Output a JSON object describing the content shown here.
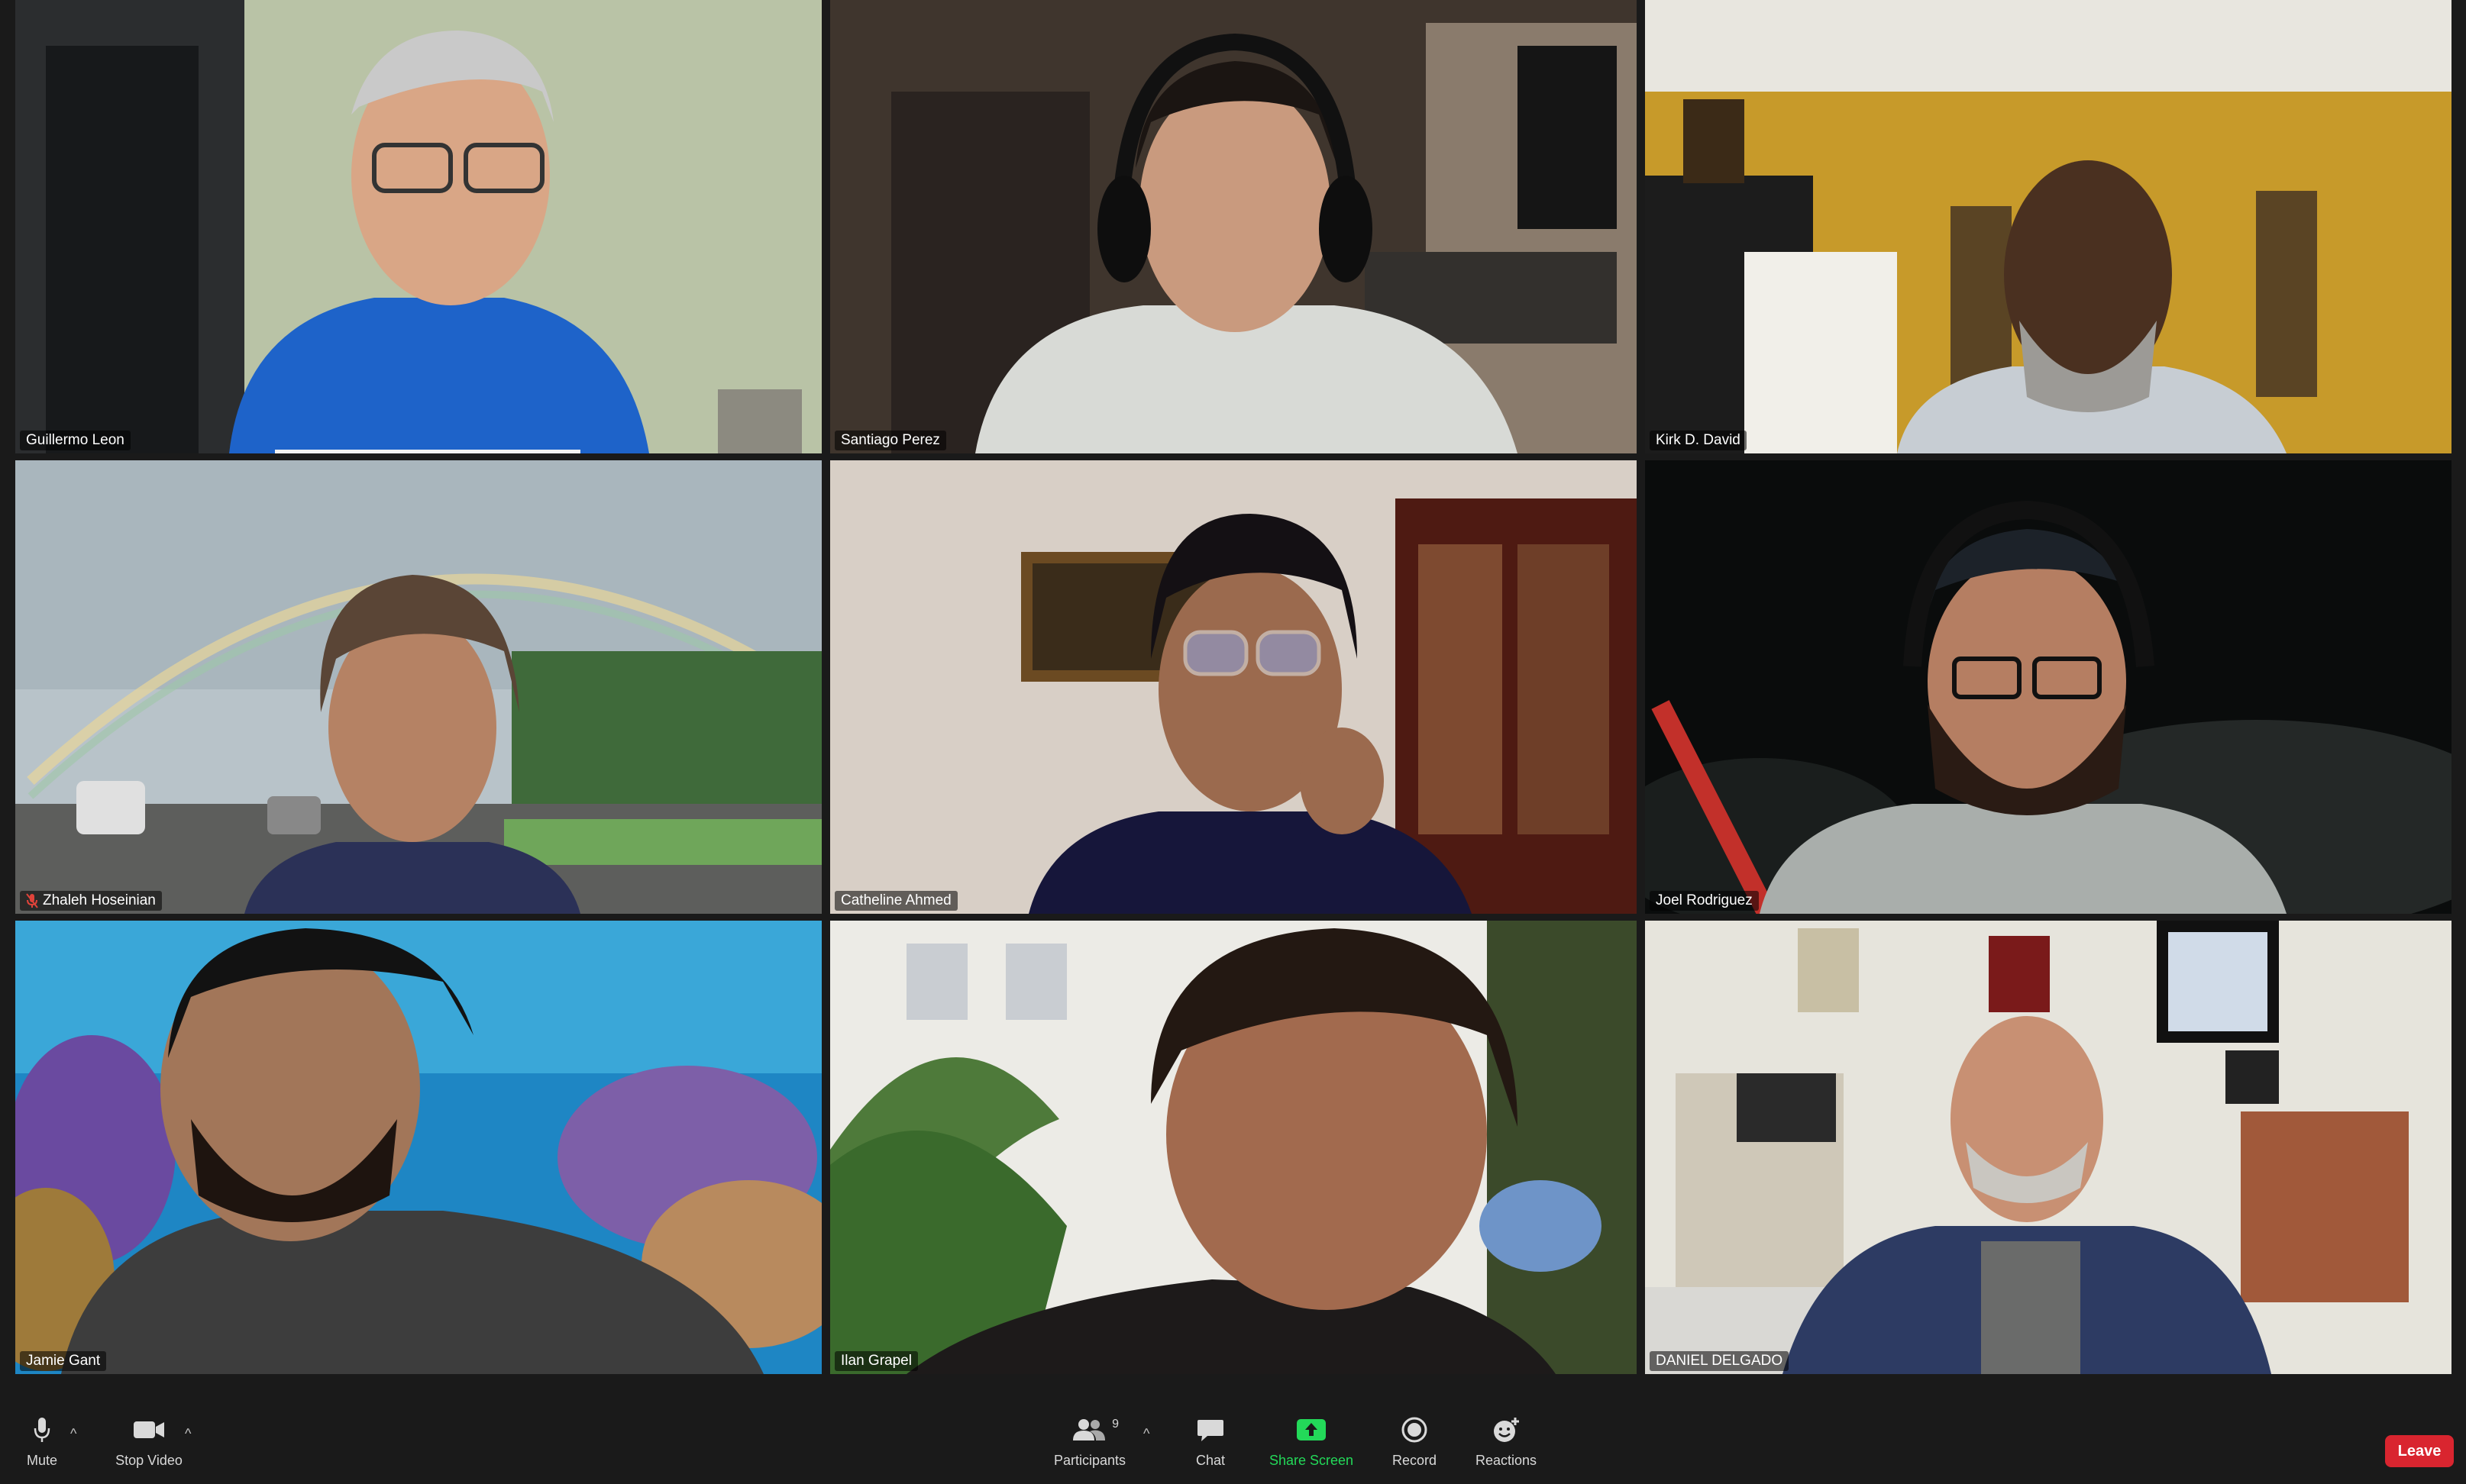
{
  "participants": [
    {
      "name": "Guillermo Leon",
      "muted": false,
      "active_speaker": false,
      "speaking_bar": true
    },
    {
      "name": "Santiago Perez",
      "muted": false,
      "active_speaker": false
    },
    {
      "name": "Kirk D. David",
      "muted": false,
      "active_speaker": false
    },
    {
      "name": "Zhaleh Hoseinian",
      "muted": true,
      "active_speaker": false
    },
    {
      "name": "Catheline Ahmed",
      "muted": false,
      "active_speaker": false
    },
    {
      "name": "Joel Rodriguez",
      "muted": false,
      "active_speaker": false
    },
    {
      "name": "Jamie Gant",
      "muted": false,
      "active_speaker": true
    },
    {
      "name": "Ilan Grapel",
      "muted": false,
      "active_speaker": false
    },
    {
      "name": "DANIEL DELGADO",
      "muted": false,
      "active_speaker": false
    }
  ],
  "toolbar": {
    "mute_label": "Mute",
    "stop_video_label": "Stop Video",
    "participants_label": "Participants",
    "participants_count": "9",
    "chat_label": "Chat",
    "share_screen_label": "Share Screen",
    "record_label": "Record",
    "reactions_label": "Reactions",
    "leave_label": "Leave"
  },
  "colors": {
    "active_speaker_border": "#e8e26a",
    "share_screen_green": "#23d959",
    "leave_red": "#d9252f",
    "background": "#1a1a1a"
  },
  "icons": {
    "mute": "microphone-icon",
    "stop_video": "video-camera-icon",
    "participants": "people-icon",
    "chat": "chat-bubble-icon",
    "share_screen": "share-screen-icon",
    "record": "record-icon",
    "reactions": "smiley-icon",
    "muted_indicator": "muted-microphone-icon"
  }
}
